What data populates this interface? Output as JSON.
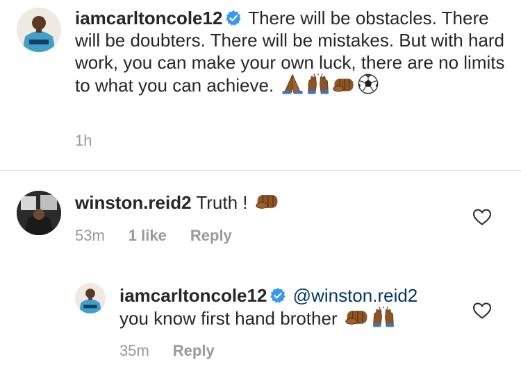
{
  "post": {
    "username": "iamcarltoncole12",
    "caption_text": "There will be obstacles. There will be doubters. There will be mistakes. But with hard work, you can make your own luck, there are no limits to what you can achieve.",
    "time": "1h",
    "emojis": [
      "folded-hands-icon",
      "raising-hands-icon",
      "oncoming-fist-icon",
      "soccer-ball-icon"
    ]
  },
  "comment": {
    "username": "winston.reid2",
    "text": "Truth !",
    "time": "53m",
    "likes": "1 like",
    "reply_label": "Reply",
    "emojis": [
      "oncoming-fist-icon"
    ]
  },
  "reply": {
    "username": "iamcarltoncole12",
    "mention": "@winston.reid2",
    "text": "you know first hand brother",
    "time": "35m",
    "reply_label": "Reply",
    "emojis": [
      "oncoming-fist-icon",
      "raising-hands-icon"
    ]
  },
  "colors": {
    "text": "#262626",
    "meta": "#999999",
    "mention": "#003569",
    "verified": "#3897f0",
    "divider": "#dbdbdb"
  }
}
